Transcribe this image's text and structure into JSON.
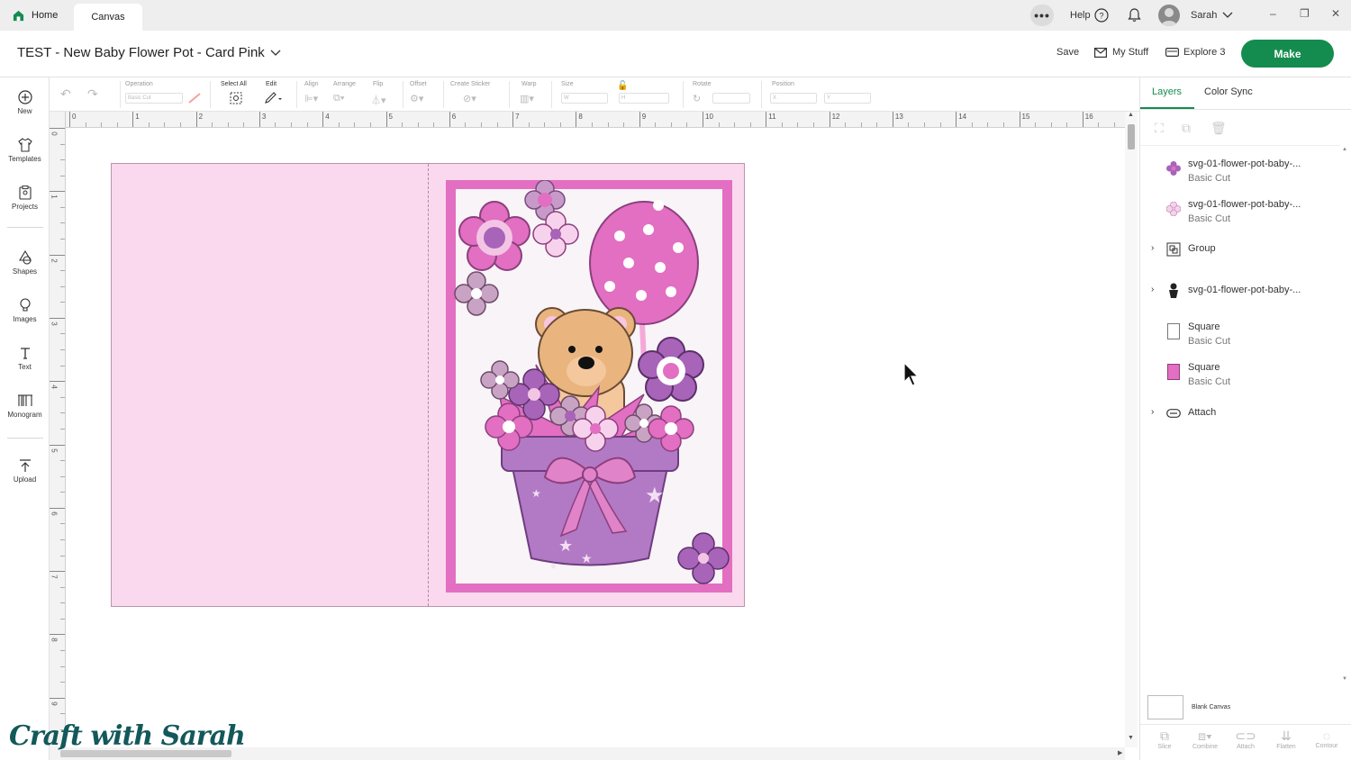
{
  "tabs": {
    "home": "Home",
    "canvas": "Canvas"
  },
  "top_right": {
    "help": "Help",
    "user": "Sarah",
    "more": "•••"
  },
  "window_controls": {
    "minimize": "–",
    "restore": "❐",
    "close": "✕"
  },
  "header": {
    "project_title": "TEST - New Baby Flower Pot - Card Pink",
    "save": "Save",
    "my_stuff": "My Stuff",
    "machine": "Explore 3",
    "make": "Make"
  },
  "sidebar": {
    "items": [
      {
        "label": "New",
        "icon": "plus-circle-icon"
      },
      {
        "label": "Templates",
        "icon": "shirt-icon"
      },
      {
        "label": "Projects",
        "icon": "clipboard-icon"
      },
      {
        "label": "Shapes",
        "icon": "shapes-icon"
      },
      {
        "label": "Images",
        "icon": "lightbulb-icon"
      },
      {
        "label": "Text",
        "icon": "text-icon"
      },
      {
        "label": "Monogram",
        "icon": "monogram-icon"
      },
      {
        "label": "Upload",
        "icon": "upload-icon"
      }
    ]
  },
  "toolbar": {
    "operation_label": "Operation",
    "operation_value": "Basic Cut",
    "select_all": "Select All",
    "edit": "Edit",
    "align": "Align",
    "arrange": "Arrange",
    "flip": "Flip",
    "offset": "Offset",
    "create_sticker": "Create Sticker",
    "warp": "Warp",
    "size": "Size",
    "size_w": "W",
    "size_h": "H",
    "rotate": "Rotate",
    "position": "Position",
    "pos_x": "X",
    "pos_y": "Y"
  },
  "ruler": {
    "top": [
      "0",
      "1",
      "2",
      "3",
      "4",
      "5",
      "6",
      "7",
      "8",
      "9",
      "10",
      "11",
      "12",
      "13",
      "14",
      "15",
      "16"
    ],
    "left": [
      "0",
      "1",
      "2",
      "3",
      "4",
      "5",
      "6",
      "7",
      "8",
      "9"
    ]
  },
  "right_panel": {
    "tabs": [
      "Layers",
      "Color Sync"
    ],
    "layers": [
      {
        "name": "svg-01-flower-pot-baby-...",
        "op": "Basic Cut",
        "icon": "flower-purple-icon",
        "expandable": false
      },
      {
        "name": "svg-01-flower-pot-baby-...",
        "op": "Basic Cut",
        "icon": "flower-pink-icon",
        "expandable": false
      },
      {
        "name": "Group",
        "op": "",
        "icon": "group-icon",
        "expandable": true
      },
      {
        "name": "svg-01-flower-pot-baby-...",
        "op": "",
        "icon": "pot-icon",
        "expandable": true
      },
      {
        "name": "Square",
        "op": "Basic Cut",
        "icon": "square-white-icon",
        "expandable": false
      },
      {
        "name": "Square",
        "op": "Basic Cut",
        "icon": "square-pink-icon",
        "expandable": false
      },
      {
        "name": "Attach",
        "op": "",
        "icon": "attach-icon",
        "expandable": true
      }
    ],
    "blank_canvas": "Blank Canvas",
    "bottom_actions": [
      "Slice",
      "Combine",
      "Attach",
      "Flatten",
      "Contour"
    ]
  },
  "watermark": "Craft with Sarah",
  "colors": {
    "brand_green": "#158c4f",
    "card_pink": "#fad8ee",
    "frame_pink": "#e26fc1",
    "pot_purple": "#b27ac5",
    "bow_pink": "#e083c8",
    "bear_tan": "#e9b47e"
  }
}
